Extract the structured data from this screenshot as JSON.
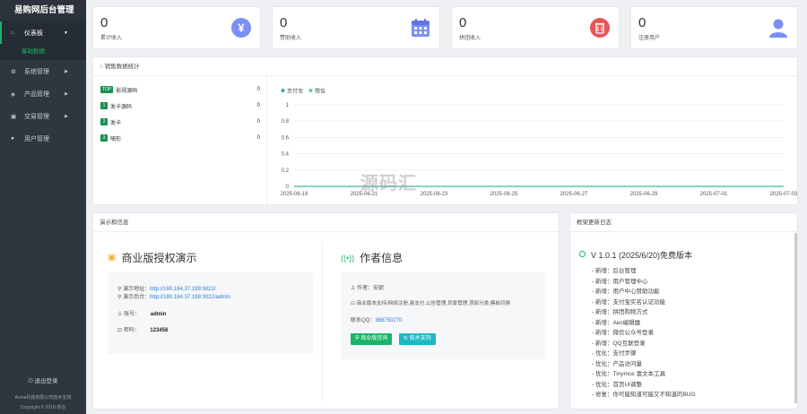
{
  "sidebar": {
    "brand": "易购网后台管理",
    "items": [
      {
        "label": "仪表板",
        "icon": "home-icon"
      },
      {
        "label": "系统管理",
        "icon": "gear-icon"
      },
      {
        "label": "产品管理",
        "icon": "cube-icon"
      },
      {
        "label": "交易管理",
        "icon": "cart-icon"
      },
      {
        "label": "用户管理",
        "icon": "user-icon"
      }
    ],
    "sub_item": "基础数据",
    "logout": "退出登录",
    "copyright_line1": "Annie科技有限公司技术支持",
    "copyright_line2": "Copyright © 2018-现在"
  },
  "stats": [
    {
      "value": "0",
      "label": "累计收入",
      "icon": "yen-icon",
      "color": "#7b8ff7"
    },
    {
      "value": "0",
      "label": "赞助收入",
      "icon": "calendar-icon",
      "color": "#7b8ff7"
    },
    {
      "value": "0",
      "label": "拼团收入",
      "icon": "trash-icon",
      "color": "#e8555b"
    },
    {
      "value": "0",
      "label": "注册用户",
      "icon": "user-icon",
      "color": "#7b8ff7"
    }
  ],
  "sales": {
    "title": "销售数据统计",
    "ranks": [
      {
        "badge": "TOP",
        "name": "影视源码",
        "value": "0"
      },
      {
        "badge": "1",
        "name": "发卡源码",
        "value": "0"
      },
      {
        "badge": "2",
        "name": "发卡",
        "value": "0"
      },
      {
        "badge": "3",
        "name": "哺形",
        "value": "0"
      }
    ]
  },
  "chart_data": {
    "type": "line",
    "legend": [
      "支付宝",
      "微信"
    ],
    "legend_colors": [
      "#2fa3c9",
      "#5cc6a5"
    ],
    "x": [
      "2025-06-19",
      "2025-06-21",
      "2025-06-23",
      "2025-06-25",
      "2025-06-27",
      "2025-06-29",
      "2025-07-01",
      "2025-07-03"
    ],
    "yticks": [
      "0",
      "0.2",
      "0.4",
      "0.6",
      "0.8",
      "1"
    ],
    "ylim": [
      0,
      1
    ],
    "series": [
      {
        "name": "支付宝",
        "values": [
          0,
          0,
          0,
          0,
          0,
          0,
          0,
          0
        ]
      },
      {
        "name": "微信",
        "values": [
          0,
          0,
          0,
          0,
          0,
          0,
          0,
          0
        ]
      }
    ],
    "grid": true
  },
  "demo": {
    "title": "演示和信息",
    "license_title": "商业版授权演示",
    "addr1_label": "演示地址：",
    "addr1": "http://180.184.37.199:3022/",
    "addr2_label": "演示后台：",
    "addr2": "http://180.184.37.199:3022/admin",
    "account_label": "账号：",
    "account": "admin",
    "password_label": "密码：",
    "password": "123456",
    "author_title": "作者信息",
    "author_label": "作者：",
    "author": "安妮",
    "desc": "商业版本支持/网络注册,易支付,公告管理,背景管理,顶部分类,模板切换",
    "qq_label": "联系QQ：",
    "qq": "368750270",
    "btn1": "商业版咨询",
    "btn2": "技术支持"
  },
  "changelog": {
    "title": "框架更新日志",
    "version": "V 1.0.1 (2025/6/20)免费版本",
    "items": [
      "- 新增：后台管理",
      "- 新增：用户管理中心",
      "- 新增：用户中心赞助功能",
      "- 新增：支付宝实名认证功能",
      "- 新增：拼团购物方式",
      "- 新增：Aec编辑器",
      "- 新增：微信公众号登录",
      "- 新增：QQ互联登录",
      "- 优化：支付步骤",
      "- 优化：产品访问量",
      "- 优化：Tinymce 富文本工具",
      "- 优化：首页UI调整",
      "- 修复：你可能知道可能又不知道的BUG"
    ]
  },
  "watermark": "源码汇"
}
